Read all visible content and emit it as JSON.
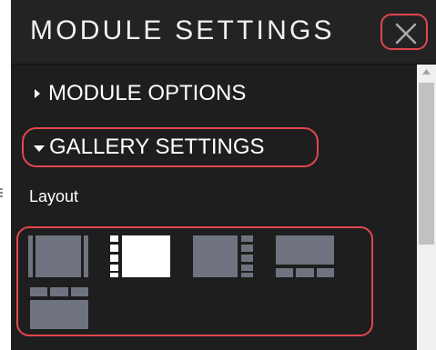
{
  "header": {
    "title": "MODULE SETTINGS",
    "close_icon": "close-icon"
  },
  "sections": [
    {
      "label": "MODULE OPTIONS",
      "expanded": false,
      "icon": "caret-right-icon"
    },
    {
      "label": "GALLERY SETTINGS",
      "expanded": true,
      "icon": "caret-down-icon"
    }
  ],
  "gallery": {
    "layout_label": "Layout",
    "layout_options": [
      {
        "name": "layout-full-with-side-strips",
        "selected": false
      },
      {
        "name": "layout-thumbnails-left-main",
        "selected": true
      },
      {
        "name": "layout-main-thumbnails-right",
        "selected": false
      },
      {
        "name": "layout-main-thumbnails-bottom",
        "selected": false
      },
      {
        "name": "layout-thumbnails-top-main",
        "selected": false
      }
    ]
  },
  "colors": {
    "panel_background": "#232323",
    "body_background": "#1e1e1e",
    "text": "#ffffff",
    "highlight_outline": "#e0474c",
    "layout_icon_inactive": "#6f7380",
    "layout_icon_active": "#ffffff"
  }
}
